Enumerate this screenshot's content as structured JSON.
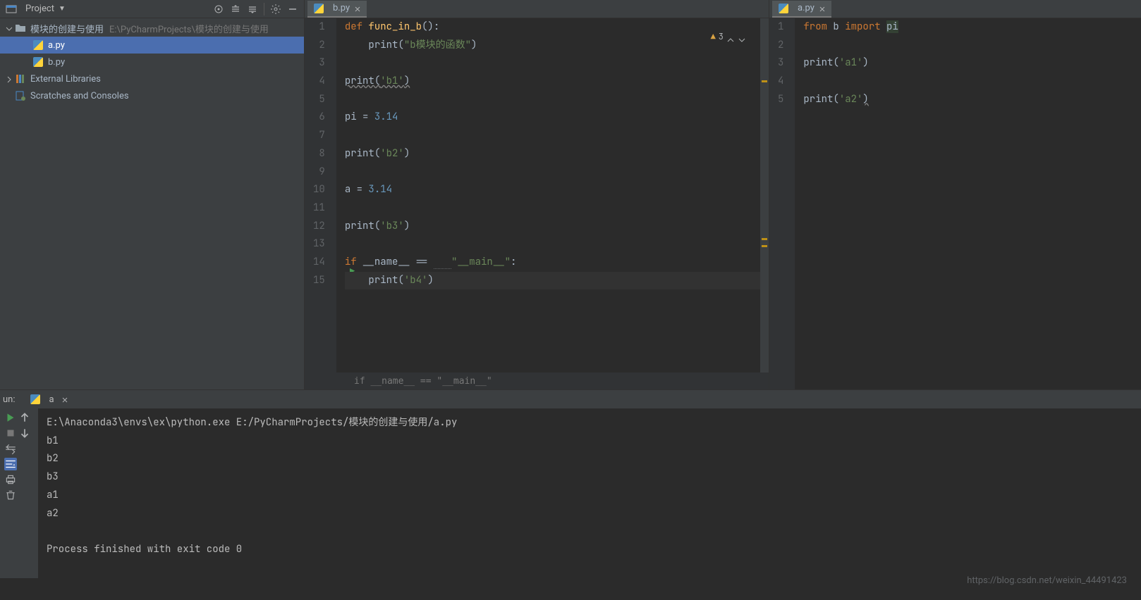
{
  "sidebar": {
    "title": "Project",
    "root": {
      "name": "模块的创建与使用",
      "path": "E:\\PyCharmProjects\\模块的创建与使用"
    },
    "files": [
      {
        "name": "a.py",
        "selected": true
      },
      {
        "name": "b.py",
        "selected": false
      }
    ],
    "external_libs": "External Libraries",
    "scratches": "Scratches and Consoles"
  },
  "tabs": {
    "left": "b.py",
    "right": "a.py"
  },
  "inspection": {
    "count": "3"
  },
  "code_b": {
    "l1": {
      "def": "def ",
      "fn": "func_in_b",
      "paren": "():"
    },
    "l2": {
      "indent": "    ",
      "call": "print",
      "paren1": "(",
      "str": "\"b模块的函数\"",
      "paren2": ")"
    },
    "l4": {
      "call": "print",
      "paren1": "(",
      "str": "'b1'",
      "paren2": ")"
    },
    "l6": {
      "left": "pi = ",
      "num": "3.14"
    },
    "l8": {
      "call": "print",
      "paren1": "(",
      "str": "'b2'",
      "paren2": ")"
    },
    "l10": {
      "left": "a = ",
      "num": "3.14"
    },
    "l12": {
      "call": "print",
      "paren1": "(",
      "str": "'b3'",
      "paren2": ")"
    },
    "l14": {
      "if": "if ",
      "name": "__name__",
      "eq": " == ",
      "main": "\"__main__\"",
      "colon": ":"
    },
    "l15": {
      "indent": "    ",
      "call": "print",
      "paren1": "(",
      "str": "'b4'",
      "paren2": ")"
    }
  },
  "breadcrumb_b": "if __name__ == \"__main__\"",
  "code_a": {
    "l1": {
      "from": "from ",
      "mod": "b ",
      "import": "import ",
      "sym": "pi"
    },
    "l3": {
      "call": "print",
      "paren1": "(",
      "str": "'a1'",
      "paren2": ")"
    },
    "l5": {
      "call": "print",
      "paren1": "(",
      "str": "'a2'",
      "paren2": ")"
    }
  },
  "run_panel": {
    "label": "un:",
    "tab": "a"
  },
  "console": {
    "cmd": "E:\\Anaconda3\\envs\\ex\\python.exe E:/PyCharmProjects/模块的创建与使用/a.py",
    "out": [
      "b1",
      "b2",
      "b3",
      "a1",
      "a2"
    ],
    "exit": "Process finished with exit code 0"
  },
  "watermark": "https://blog.csdn.net/weixin_44491423"
}
